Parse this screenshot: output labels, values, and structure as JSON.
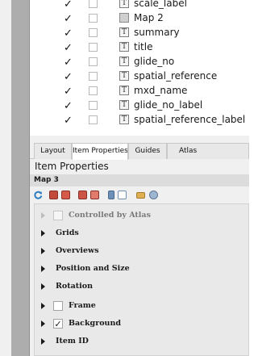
{
  "items": [
    {
      "visible": "✓",
      "type": "T",
      "name": "scale_label"
    },
    {
      "visible": "✓",
      "type": "map",
      "name": "Map 2"
    },
    {
      "visible": "✓",
      "type": "T",
      "name": "summary"
    },
    {
      "visible": "✓",
      "type": "T",
      "name": "title"
    },
    {
      "visible": "✓",
      "type": "T",
      "name": "glide_no"
    },
    {
      "visible": "✓",
      "type": "T",
      "name": "spatial_reference"
    },
    {
      "visible": "✓",
      "type": "T",
      "name": "mxd_name"
    },
    {
      "visible": "✓",
      "type": "T",
      "name": "glide_no_label"
    },
    {
      "visible": "✓",
      "type": "T",
      "name": "spatial_reference_label"
    }
  ],
  "tabs": {
    "layout": "Layout",
    "item_properties": "Item Properties",
    "guides": "Guides",
    "atlas": "Atlas"
  },
  "panel_title": "Item Properties",
  "section_title": "Map 3",
  "toolbar_icons": [
    "refresh-icon",
    "lock-layers-icon",
    "lock-styles-icon",
    "layer-set-icon",
    "layer-style-icon",
    "map-scale-icon",
    "map-extent-icon",
    "view-extent-icon",
    "bookmark-icon"
  ],
  "properties": {
    "controlled_by_atlas": {
      "label": "Controlled by Atlas",
      "checked": ""
    },
    "grids": "Grids",
    "overviews": "Overviews",
    "position_and_size": "Position and Size",
    "rotation": "Rotation",
    "frame": {
      "label": "Frame",
      "checked": ""
    },
    "background": {
      "label": "Background",
      "checked": "✓"
    },
    "item_id": "Item ID"
  },
  "colors": {
    "accent": "#2f7fc1",
    "panel": "#f0f0f0"
  }
}
